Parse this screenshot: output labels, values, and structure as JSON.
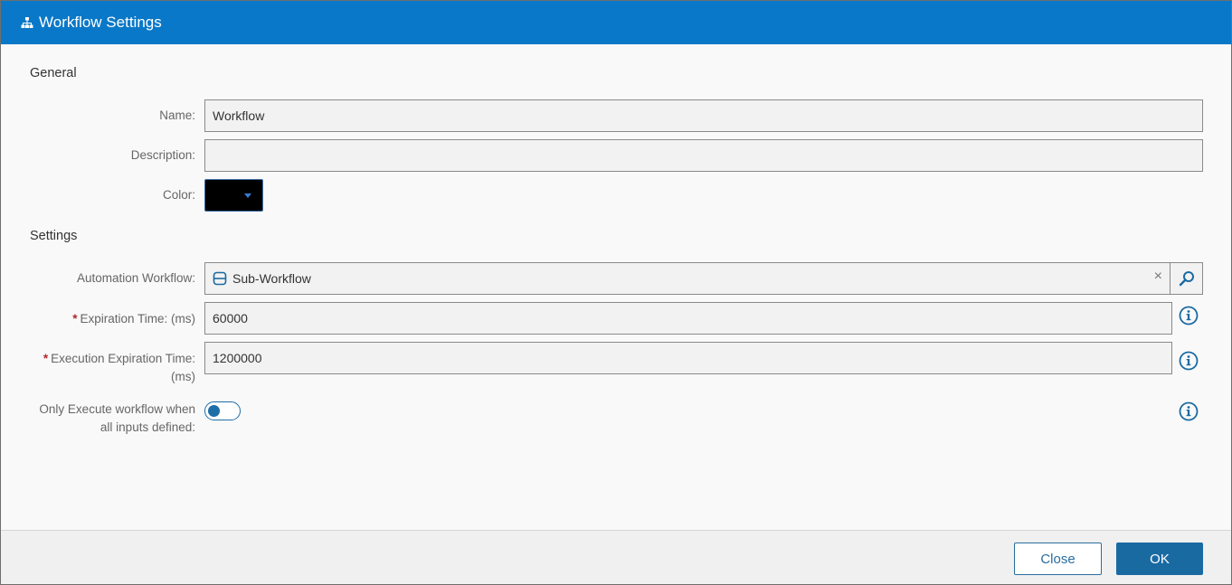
{
  "dialog": {
    "title": "Workflow Settings",
    "title_icon": "hierarchy-icon"
  },
  "general": {
    "heading": "General",
    "name_label": "Name:",
    "name_value": "Workflow",
    "description_label": "Description:",
    "description_value": "",
    "color_label": "Color:",
    "color_value": "#000000"
  },
  "settings": {
    "heading": "Settings",
    "automation_workflow_label": "Automation Workflow:",
    "automation_workflow_value": "Sub-Workflow",
    "automation_workflow_icon": "workflow-icon",
    "clear_glyph": "×",
    "required_marker": "*",
    "expiration_time_label": "Expiration Time: (ms)",
    "expiration_time_value": "60000",
    "execution_expiration_label_line1": "Execution Expiration Time:",
    "execution_expiration_label_line2": "(ms)",
    "execution_expiration_value": "1200000",
    "only_execute_label_line1": "Only Execute workflow when",
    "only_execute_label_line2": "all inputs defined:",
    "only_execute_enabled": false
  },
  "footer": {
    "close_label": "Close",
    "ok_label": "OK"
  },
  "colors": {
    "titlebar": "#0a78c8",
    "accent": "#1a6aa2",
    "required": "#b3262b"
  }
}
